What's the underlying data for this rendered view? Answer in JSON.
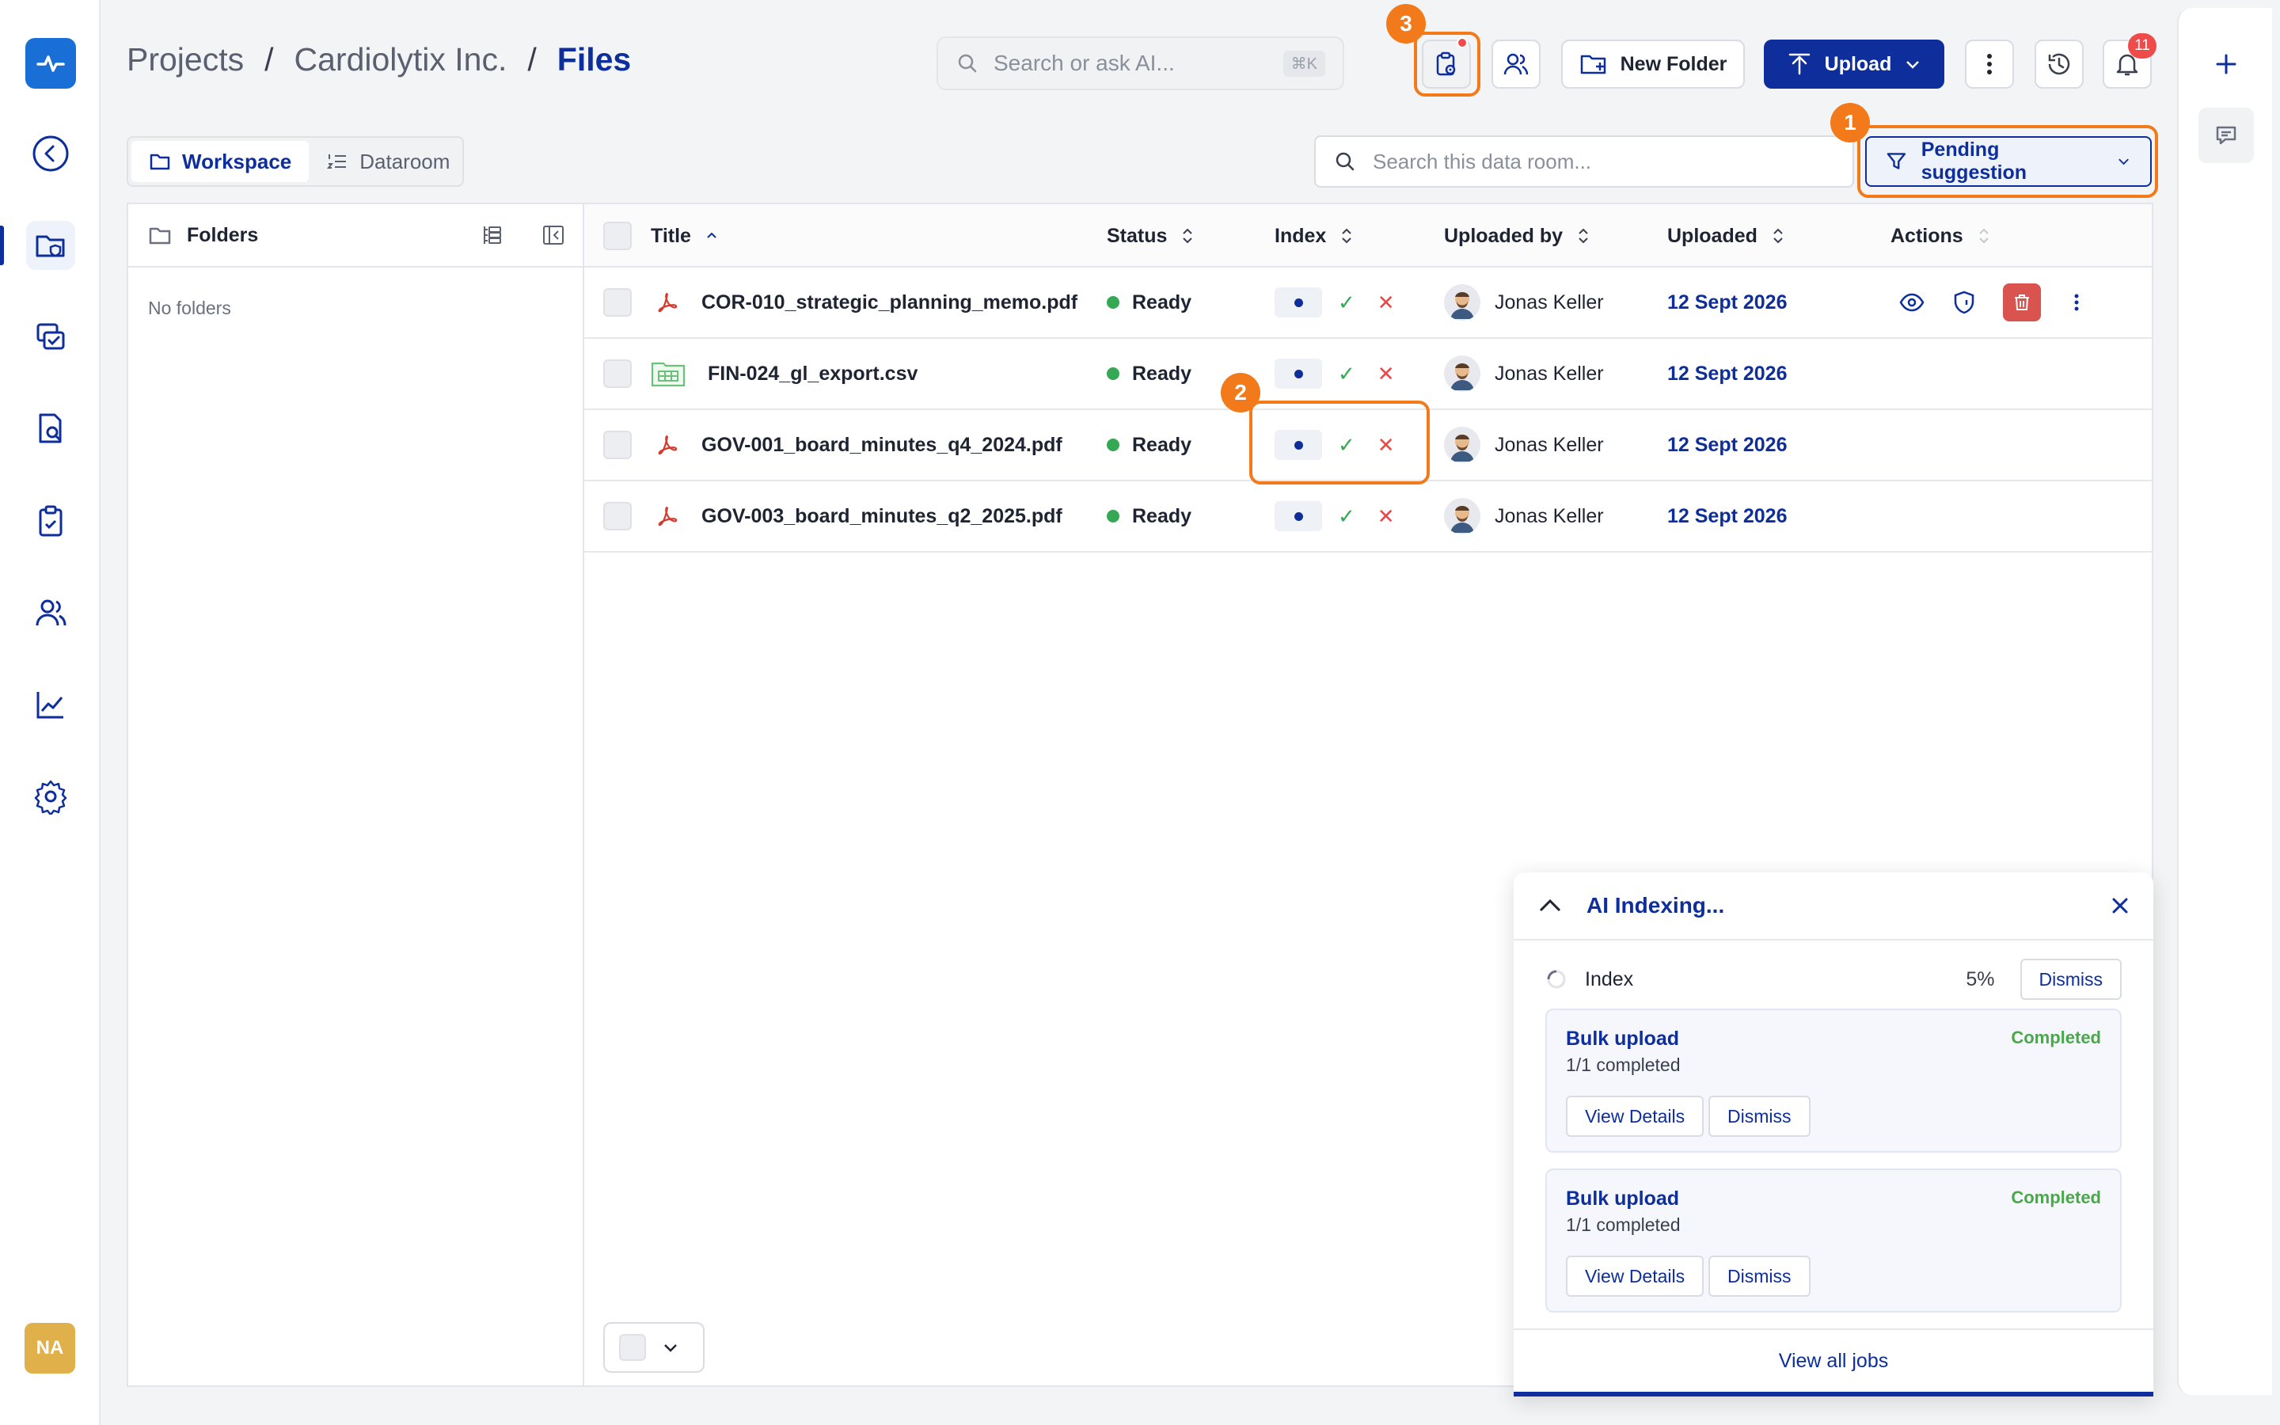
{
  "breadcrumb": {
    "items": [
      "Projects",
      "Cardiolytix Inc.",
      "Files"
    ],
    "separator": "/"
  },
  "search": {
    "placeholder": "Search or ask AI...",
    "shortcut": "⌘K"
  },
  "toolbar": {
    "new_folder": "New Folder",
    "upload": "Upload",
    "notifications_count": "11"
  },
  "tabs": {
    "workspace": "Workspace",
    "dataroom": "Dataroom"
  },
  "dataroom_search": {
    "placeholder": "Search this data room..."
  },
  "filter": {
    "label": "Pending suggestion"
  },
  "callouts": [
    "1",
    "2",
    "3"
  ],
  "folders": {
    "title": "Folders",
    "empty": "No folders"
  },
  "table": {
    "columns": [
      "Title",
      "Status",
      "Index",
      "Uploaded by",
      "Uploaded",
      "Actions"
    ],
    "rows": [
      {
        "title": "COR-010_strategic_planning_memo.pdf",
        "type": "pdf",
        "status": "Ready",
        "uploader": "Jonas Keller",
        "date": "12 Sept 2026"
      },
      {
        "title": "FIN-024_gl_export.csv",
        "type": "csv",
        "status": "Ready",
        "uploader": "Jonas Keller",
        "date": "12 Sept 2026"
      },
      {
        "title": "GOV-001_board_minutes_q4_2024.pdf",
        "type": "pdf",
        "status": "Ready",
        "uploader": "Jonas Keller",
        "date": "12 Sept 2026"
      },
      {
        "title": "GOV-003_board_minutes_q2_2025.pdf",
        "type": "pdf",
        "status": "Ready",
        "uploader": "Jonas Keller",
        "date": "12 Sept 2026"
      }
    ]
  },
  "ai_panel": {
    "title": "AI Indexing...",
    "index_label": "Index",
    "index_progress": "5%",
    "dismiss": "Dismiss",
    "jobs": [
      {
        "title": "Bulk upload",
        "sub": "1/1 completed",
        "status": "Completed",
        "view": "View Details",
        "dismiss": "Dismiss"
      },
      {
        "title": "Bulk upload",
        "sub": "1/1 completed",
        "status": "Completed",
        "view": "View Details",
        "dismiss": "Dismiss"
      }
    ],
    "view_all": "View all jobs"
  },
  "user": {
    "initials": "NA"
  },
  "colors": {
    "primary": "#0d2e9b",
    "accent": "#f27a1a",
    "success": "#34a853",
    "danger": "#e04b4b"
  }
}
